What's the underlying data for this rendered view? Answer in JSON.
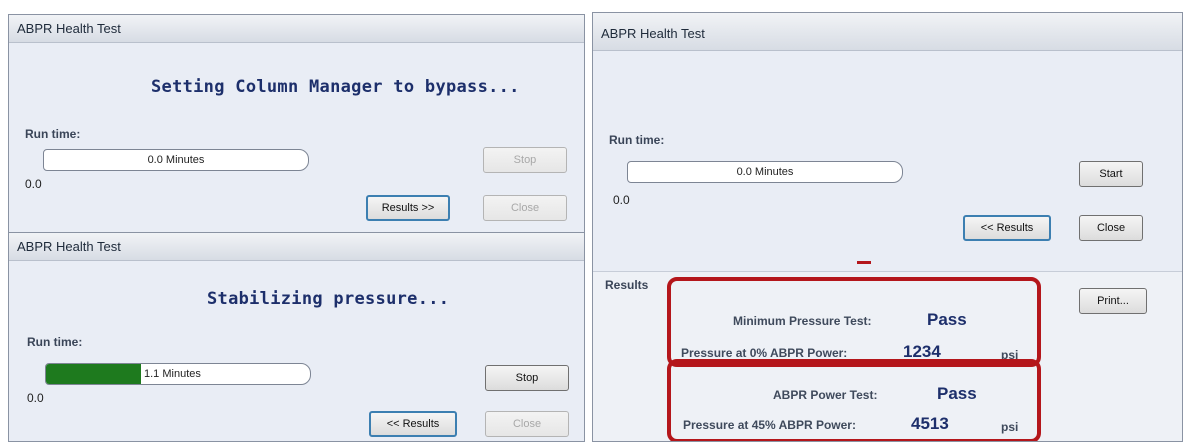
{
  "dialog1": {
    "title": "ABPR Health Test",
    "status": "Setting Column Manager to bypass...",
    "run_time_label": "Run time:",
    "progress_text": "0.0 Minutes",
    "progress_fraction": 0,
    "start_value": "0.0",
    "stop_label": "Stop",
    "results_label": "Results >>",
    "close_label": "Close"
  },
  "dialog2": {
    "title": "ABPR Health Test",
    "status": "Stabilizing pressure...",
    "run_time_label": "Run time:",
    "progress_text": "1.1 Minutes",
    "progress_fraction": 0.36,
    "start_value": "0.0",
    "stop_label": "Stop",
    "results_label": "<< Results",
    "close_label": "Close"
  },
  "dialog3": {
    "title": "ABPR Health Test",
    "run_time_label": "Run time:",
    "progress_text": "0.0 Minutes",
    "progress_fraction": 0,
    "start_value": "0.0",
    "start_label": "Start",
    "results_label": "<< Results",
    "close_label": "Close",
    "results_heading": "Results",
    "print_label": "Print...",
    "tests": [
      {
        "name_label": "Minimum Pressure Test:",
        "result": "Pass",
        "pressure_label": "Pressure at 0% ABPR Power:",
        "pressure_value": "1234",
        "unit": "psi"
      },
      {
        "name_label": "ABPR Power Test:",
        "result": "Pass",
        "pressure_label": "Pressure at 45% ABPR Power:",
        "pressure_value": "4513",
        "unit": "psi"
      }
    ],
    "highlight_color": "#b4161b"
  }
}
